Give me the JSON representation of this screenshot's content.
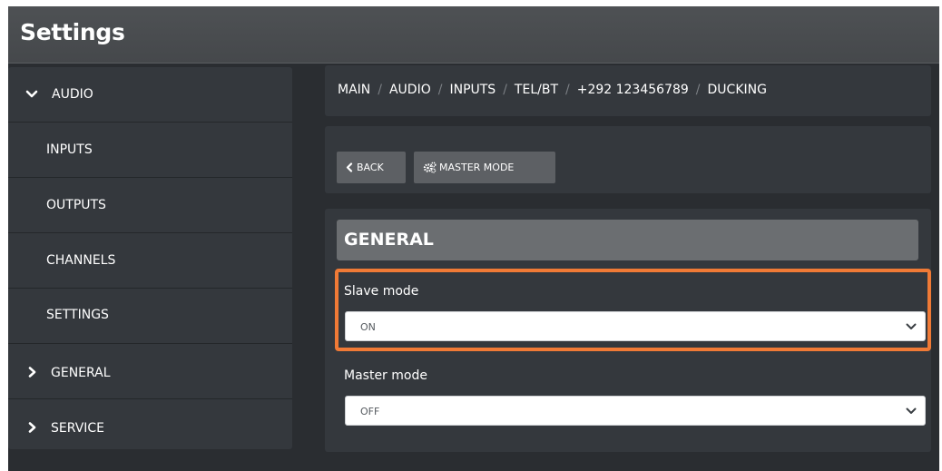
{
  "window": {
    "title": "Settings"
  },
  "sidebar": {
    "items": [
      {
        "label": "AUDIO",
        "icon": "chevron-down-icon",
        "expanded": true
      },
      {
        "label": "INPUTS"
      },
      {
        "label": "OUTPUTS"
      },
      {
        "label": "CHANNELS"
      },
      {
        "label": "SETTINGS"
      },
      {
        "label": "GENERAL",
        "icon": "chevron-right-icon",
        "expanded": false
      },
      {
        "label": "SERVICE",
        "icon": "chevron-right-icon",
        "expanded": false
      }
    ]
  },
  "breadcrumb": {
    "items": [
      "MAIN",
      "AUDIO",
      "INPUTS",
      "TEL/BT",
      "+292 123456789",
      "DUCKING"
    ],
    "separator": "/"
  },
  "toolbar": {
    "back_label": "BACK",
    "back_icon": "chevron-left-icon",
    "master_mode_label": "MASTER MODE",
    "master_mode_icon": "cogs-icon"
  },
  "section": {
    "title": "GENERAL"
  },
  "fields": {
    "slave_mode": {
      "label": "Slave mode",
      "value": "ON"
    },
    "master_mode": {
      "label": "Master mode",
      "value": "OFF"
    }
  },
  "colors": {
    "highlight": "#f07a36",
    "background": "#2a2d31",
    "panel": "#34383d",
    "button": "#5d6064",
    "section_header": "#6b6e71"
  }
}
